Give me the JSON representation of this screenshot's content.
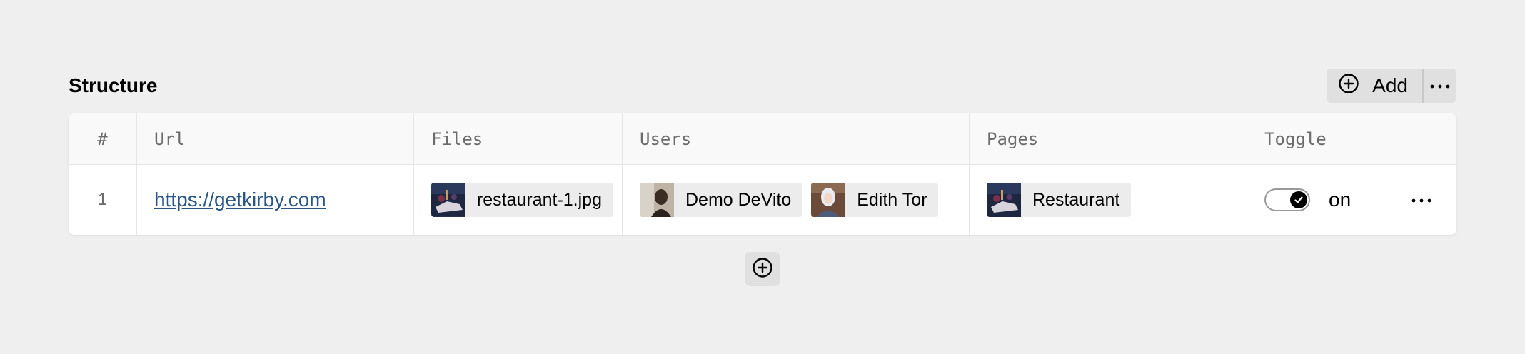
{
  "section": {
    "title": "Structure",
    "add_label": "Add",
    "add_icon": "plus-circle-icon",
    "more_icon": "dots-icon"
  },
  "table": {
    "columns": [
      "#",
      "Url",
      "Files",
      "Users",
      "Pages",
      "Toggle"
    ],
    "rows": [
      {
        "index": "1",
        "url": "https://getkirby.com",
        "files": [
          {
            "name": "restaurant-1.jpg"
          }
        ],
        "users": [
          {
            "name": "Demo DeVito"
          },
          {
            "name": "Edith Tor"
          }
        ],
        "pages": [
          {
            "title": "Restaurant"
          }
        ],
        "toggle": {
          "value": true,
          "label": "on"
        }
      }
    ]
  },
  "add_row_icon": "plus-circle-icon"
}
